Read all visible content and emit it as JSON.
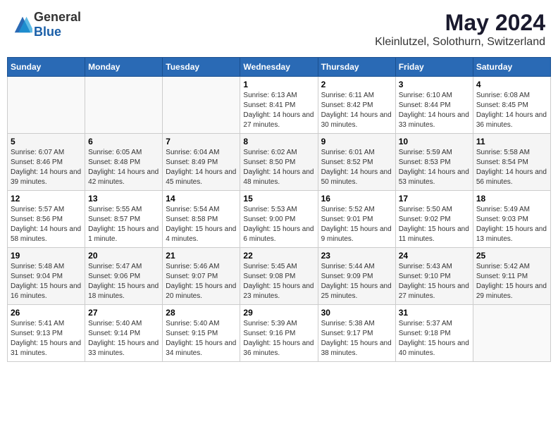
{
  "header": {
    "logo": {
      "general": "General",
      "blue": "Blue"
    },
    "title": "May 2024",
    "subtitle": "Kleinlutzel, Solothurn, Switzerland"
  },
  "weekdays": [
    "Sunday",
    "Monday",
    "Tuesday",
    "Wednesday",
    "Thursday",
    "Friday",
    "Saturday"
  ],
  "weeks": [
    [
      {
        "day": "",
        "info": ""
      },
      {
        "day": "",
        "info": ""
      },
      {
        "day": "",
        "info": ""
      },
      {
        "day": "1",
        "info": "Sunrise: 6:13 AM\nSunset: 8:41 PM\nDaylight: 14 hours and 27 minutes."
      },
      {
        "day": "2",
        "info": "Sunrise: 6:11 AM\nSunset: 8:42 PM\nDaylight: 14 hours and 30 minutes."
      },
      {
        "day": "3",
        "info": "Sunrise: 6:10 AM\nSunset: 8:44 PM\nDaylight: 14 hours and 33 minutes."
      },
      {
        "day": "4",
        "info": "Sunrise: 6:08 AM\nSunset: 8:45 PM\nDaylight: 14 hours and 36 minutes."
      }
    ],
    [
      {
        "day": "5",
        "info": "Sunrise: 6:07 AM\nSunset: 8:46 PM\nDaylight: 14 hours and 39 minutes."
      },
      {
        "day": "6",
        "info": "Sunrise: 6:05 AM\nSunset: 8:48 PM\nDaylight: 14 hours and 42 minutes."
      },
      {
        "day": "7",
        "info": "Sunrise: 6:04 AM\nSunset: 8:49 PM\nDaylight: 14 hours and 45 minutes."
      },
      {
        "day": "8",
        "info": "Sunrise: 6:02 AM\nSunset: 8:50 PM\nDaylight: 14 hours and 48 minutes."
      },
      {
        "day": "9",
        "info": "Sunrise: 6:01 AM\nSunset: 8:52 PM\nDaylight: 14 hours and 50 minutes."
      },
      {
        "day": "10",
        "info": "Sunrise: 5:59 AM\nSunset: 8:53 PM\nDaylight: 14 hours and 53 minutes."
      },
      {
        "day": "11",
        "info": "Sunrise: 5:58 AM\nSunset: 8:54 PM\nDaylight: 14 hours and 56 minutes."
      }
    ],
    [
      {
        "day": "12",
        "info": "Sunrise: 5:57 AM\nSunset: 8:56 PM\nDaylight: 14 hours and 58 minutes."
      },
      {
        "day": "13",
        "info": "Sunrise: 5:55 AM\nSunset: 8:57 PM\nDaylight: 15 hours and 1 minute."
      },
      {
        "day": "14",
        "info": "Sunrise: 5:54 AM\nSunset: 8:58 PM\nDaylight: 15 hours and 4 minutes."
      },
      {
        "day": "15",
        "info": "Sunrise: 5:53 AM\nSunset: 9:00 PM\nDaylight: 15 hours and 6 minutes."
      },
      {
        "day": "16",
        "info": "Sunrise: 5:52 AM\nSunset: 9:01 PM\nDaylight: 15 hours and 9 minutes."
      },
      {
        "day": "17",
        "info": "Sunrise: 5:50 AM\nSunset: 9:02 PM\nDaylight: 15 hours and 11 minutes."
      },
      {
        "day": "18",
        "info": "Sunrise: 5:49 AM\nSunset: 9:03 PM\nDaylight: 15 hours and 13 minutes."
      }
    ],
    [
      {
        "day": "19",
        "info": "Sunrise: 5:48 AM\nSunset: 9:04 PM\nDaylight: 15 hours and 16 minutes."
      },
      {
        "day": "20",
        "info": "Sunrise: 5:47 AM\nSunset: 9:06 PM\nDaylight: 15 hours and 18 minutes."
      },
      {
        "day": "21",
        "info": "Sunrise: 5:46 AM\nSunset: 9:07 PM\nDaylight: 15 hours and 20 minutes."
      },
      {
        "day": "22",
        "info": "Sunrise: 5:45 AM\nSunset: 9:08 PM\nDaylight: 15 hours and 23 minutes."
      },
      {
        "day": "23",
        "info": "Sunrise: 5:44 AM\nSunset: 9:09 PM\nDaylight: 15 hours and 25 minutes."
      },
      {
        "day": "24",
        "info": "Sunrise: 5:43 AM\nSunset: 9:10 PM\nDaylight: 15 hours and 27 minutes."
      },
      {
        "day": "25",
        "info": "Sunrise: 5:42 AM\nSunset: 9:11 PM\nDaylight: 15 hours and 29 minutes."
      }
    ],
    [
      {
        "day": "26",
        "info": "Sunrise: 5:41 AM\nSunset: 9:13 PM\nDaylight: 15 hours and 31 minutes."
      },
      {
        "day": "27",
        "info": "Sunrise: 5:40 AM\nSunset: 9:14 PM\nDaylight: 15 hours and 33 minutes."
      },
      {
        "day": "28",
        "info": "Sunrise: 5:40 AM\nSunset: 9:15 PM\nDaylight: 15 hours and 34 minutes."
      },
      {
        "day": "29",
        "info": "Sunrise: 5:39 AM\nSunset: 9:16 PM\nDaylight: 15 hours and 36 minutes."
      },
      {
        "day": "30",
        "info": "Sunrise: 5:38 AM\nSunset: 9:17 PM\nDaylight: 15 hours and 38 minutes."
      },
      {
        "day": "31",
        "info": "Sunrise: 5:37 AM\nSunset: 9:18 PM\nDaylight: 15 hours and 40 minutes."
      },
      {
        "day": "",
        "info": ""
      }
    ]
  ]
}
